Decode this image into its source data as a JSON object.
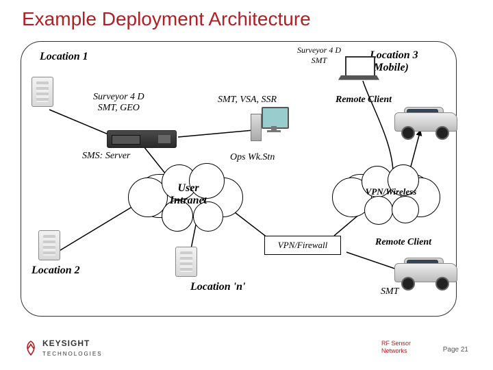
{
  "title": "Example Deployment Architecture",
  "locations": {
    "loc1": "Location 1",
    "loc2": "Location 2",
    "locn": "Location 'n'",
    "loc3_line1": "Location 3",
    "loc3_line2": "(Mobile)"
  },
  "labels": {
    "surveyor_smt_geo_l1": "Surveyor 4 D",
    "surveyor_smt_geo_l2": "SMT, GEO",
    "sms_server": "SMS: Server",
    "smt_vsa_ssr": "SMT, VSA, SSR",
    "ops_wkstn": "Ops Wk.Stn",
    "surveyor_smt_l1": "Surveyor 4 D",
    "surveyor_smt_l2": "SMT",
    "remote_client_1": "Remote Client",
    "remote_client_2": "Remote Client",
    "smt_standalone": "SMT"
  },
  "clouds": {
    "user_intranet": "User\nIntranet",
    "vpn_wireless": "VPN/Wireless"
  },
  "boxes": {
    "vpn_firewall": "VPN/Firewall"
  },
  "footer": {
    "brand_bold": "KEYSIGHT",
    "brand_light": "TECHNOLOGIES",
    "rf": "RF Sensor\nNetworks",
    "page": "Page 21"
  }
}
